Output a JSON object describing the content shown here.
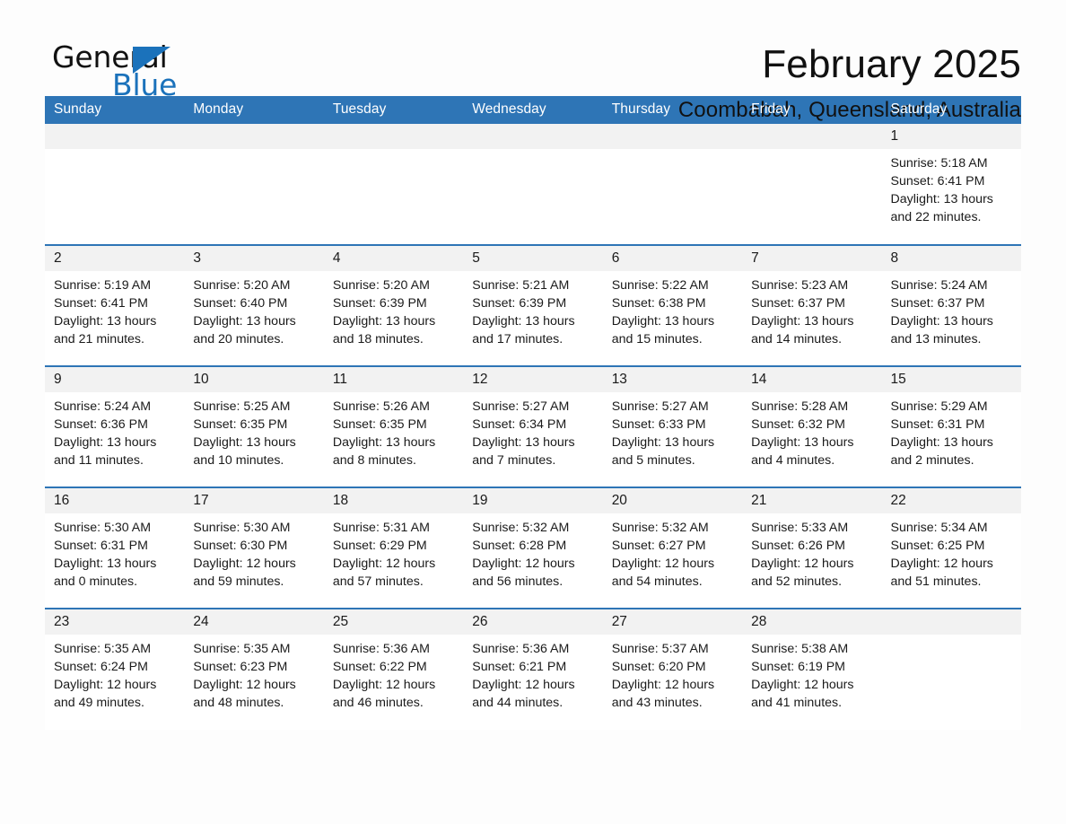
{
  "logo": {
    "word_top": "General",
    "word_bottom": "Blue",
    "accent_color": "#1b72bb"
  },
  "header": {
    "title": "February 2025",
    "subtitle": "Coombabah, Queensland, Australia"
  },
  "theme": {
    "header_blue": "#2e75b6",
    "daynum_band": "#f2f2f2",
    "page_background": "#fdfdfd",
    "text": "#1a1a1a"
  },
  "calendar": {
    "weekday_headers": [
      "Sunday",
      "Monday",
      "Tuesday",
      "Wednesday",
      "Thursday",
      "Friday",
      "Saturday"
    ],
    "labels": {
      "sunrise": "Sunrise:",
      "sunset": "Sunset:",
      "daylight": "Daylight:"
    },
    "weeks": [
      [
        {
          "day": "",
          "empty": true
        },
        {
          "day": "",
          "empty": true
        },
        {
          "day": "",
          "empty": true
        },
        {
          "day": "",
          "empty": true
        },
        {
          "day": "",
          "empty": true
        },
        {
          "day": "",
          "empty": true
        },
        {
          "day": "1",
          "sunrise": "Sunrise: 5:18 AM",
          "sunset": "Sunset: 6:41 PM",
          "daylight": "Daylight: 13 hours and 22 minutes."
        }
      ],
      [
        {
          "day": "2",
          "sunrise": "Sunrise: 5:19 AM",
          "sunset": "Sunset: 6:41 PM",
          "daylight": "Daylight: 13 hours and 21 minutes."
        },
        {
          "day": "3",
          "sunrise": "Sunrise: 5:20 AM",
          "sunset": "Sunset: 6:40 PM",
          "daylight": "Daylight: 13 hours and 20 minutes."
        },
        {
          "day": "4",
          "sunrise": "Sunrise: 5:20 AM",
          "sunset": "Sunset: 6:39 PM",
          "daylight": "Daylight: 13 hours and 18 minutes."
        },
        {
          "day": "5",
          "sunrise": "Sunrise: 5:21 AM",
          "sunset": "Sunset: 6:39 PM",
          "daylight": "Daylight: 13 hours and 17 minutes."
        },
        {
          "day": "6",
          "sunrise": "Sunrise: 5:22 AM",
          "sunset": "Sunset: 6:38 PM",
          "daylight": "Daylight: 13 hours and 15 minutes."
        },
        {
          "day": "7",
          "sunrise": "Sunrise: 5:23 AM",
          "sunset": "Sunset: 6:37 PM",
          "daylight": "Daylight: 13 hours and 14 minutes."
        },
        {
          "day": "8",
          "sunrise": "Sunrise: 5:24 AM",
          "sunset": "Sunset: 6:37 PM",
          "daylight": "Daylight: 13 hours and 13 minutes."
        }
      ],
      [
        {
          "day": "9",
          "sunrise": "Sunrise: 5:24 AM",
          "sunset": "Sunset: 6:36 PM",
          "daylight": "Daylight: 13 hours and 11 minutes."
        },
        {
          "day": "10",
          "sunrise": "Sunrise: 5:25 AM",
          "sunset": "Sunset: 6:35 PM",
          "daylight": "Daylight: 13 hours and 10 minutes."
        },
        {
          "day": "11",
          "sunrise": "Sunrise: 5:26 AM",
          "sunset": "Sunset: 6:35 PM",
          "daylight": "Daylight: 13 hours and 8 minutes."
        },
        {
          "day": "12",
          "sunrise": "Sunrise: 5:27 AM",
          "sunset": "Sunset: 6:34 PM",
          "daylight": "Daylight: 13 hours and 7 minutes."
        },
        {
          "day": "13",
          "sunrise": "Sunrise: 5:27 AM",
          "sunset": "Sunset: 6:33 PM",
          "daylight": "Daylight: 13 hours and 5 minutes."
        },
        {
          "day": "14",
          "sunrise": "Sunrise: 5:28 AM",
          "sunset": "Sunset: 6:32 PM",
          "daylight": "Daylight: 13 hours and 4 minutes."
        },
        {
          "day": "15",
          "sunrise": "Sunrise: 5:29 AM",
          "sunset": "Sunset: 6:31 PM",
          "daylight": "Daylight: 13 hours and 2 minutes."
        }
      ],
      [
        {
          "day": "16",
          "sunrise": "Sunrise: 5:30 AM",
          "sunset": "Sunset: 6:31 PM",
          "daylight": "Daylight: 13 hours and 0 minutes."
        },
        {
          "day": "17",
          "sunrise": "Sunrise: 5:30 AM",
          "sunset": "Sunset: 6:30 PM",
          "daylight": "Daylight: 12 hours and 59 minutes."
        },
        {
          "day": "18",
          "sunrise": "Sunrise: 5:31 AM",
          "sunset": "Sunset: 6:29 PM",
          "daylight": "Daylight: 12 hours and 57 minutes."
        },
        {
          "day": "19",
          "sunrise": "Sunrise: 5:32 AM",
          "sunset": "Sunset: 6:28 PM",
          "daylight": "Daylight: 12 hours and 56 minutes."
        },
        {
          "day": "20",
          "sunrise": "Sunrise: 5:32 AM",
          "sunset": "Sunset: 6:27 PM",
          "daylight": "Daylight: 12 hours and 54 minutes."
        },
        {
          "day": "21",
          "sunrise": "Sunrise: 5:33 AM",
          "sunset": "Sunset: 6:26 PM",
          "daylight": "Daylight: 12 hours and 52 minutes."
        },
        {
          "day": "22",
          "sunrise": "Sunrise: 5:34 AM",
          "sunset": "Sunset: 6:25 PM",
          "daylight": "Daylight: 12 hours and 51 minutes."
        }
      ],
      [
        {
          "day": "23",
          "sunrise": "Sunrise: 5:35 AM",
          "sunset": "Sunset: 6:24 PM",
          "daylight": "Daylight: 12 hours and 49 minutes."
        },
        {
          "day": "24",
          "sunrise": "Sunrise: 5:35 AM",
          "sunset": "Sunset: 6:23 PM",
          "daylight": "Daylight: 12 hours and 48 minutes."
        },
        {
          "day": "25",
          "sunrise": "Sunrise: 5:36 AM",
          "sunset": "Sunset: 6:22 PM",
          "daylight": "Daylight: 12 hours and 46 minutes."
        },
        {
          "day": "26",
          "sunrise": "Sunrise: 5:36 AM",
          "sunset": "Sunset: 6:21 PM",
          "daylight": "Daylight: 12 hours and 44 minutes."
        },
        {
          "day": "27",
          "sunrise": "Sunrise: 5:37 AM",
          "sunset": "Sunset: 6:20 PM",
          "daylight": "Daylight: 12 hours and 43 minutes."
        },
        {
          "day": "28",
          "sunrise": "Sunrise: 5:38 AM",
          "sunset": "Sunset: 6:19 PM",
          "daylight": "Daylight: 12 hours and 41 minutes."
        },
        {
          "day": "",
          "empty": true
        }
      ]
    ]
  }
}
